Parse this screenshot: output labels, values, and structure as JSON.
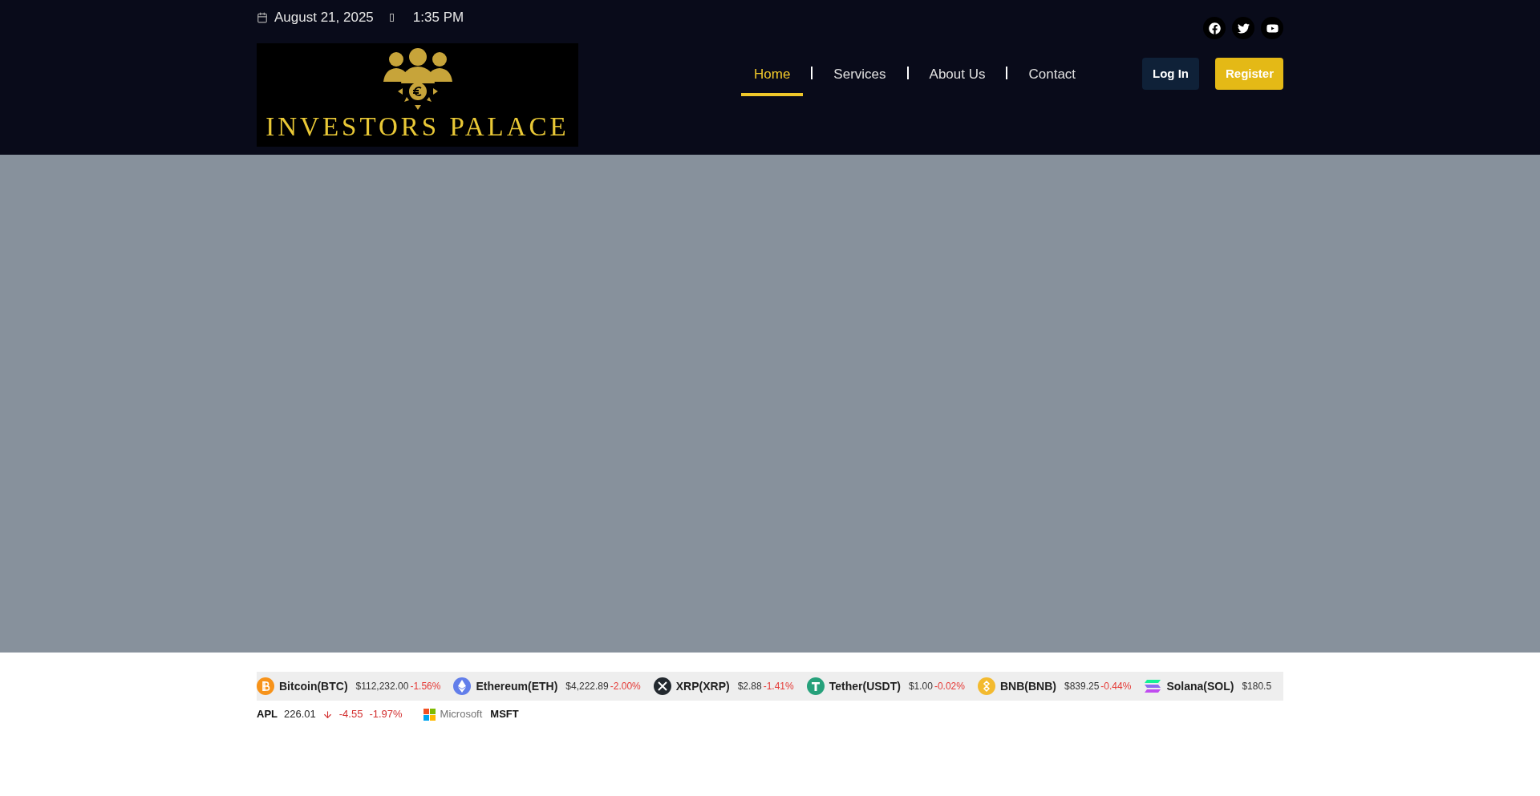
{
  "topbar": {
    "date": "August 21, 2025",
    "time": "1:35 PM"
  },
  "logo": {
    "text": "INVESTORS PALACE"
  },
  "nav": [
    {
      "label": "Home",
      "selected": true
    },
    {
      "label": "Services",
      "selected": false
    },
    {
      "label": "About Us",
      "selected": false
    },
    {
      "label": "Contact",
      "selected": false
    }
  ],
  "buttons": [
    {
      "label": "Log In",
      "kind": "secondary"
    },
    {
      "label": "Register",
      "kind": "primary"
    }
  ],
  "social": [
    {
      "kind": "facebook"
    },
    {
      "kind": "twitter"
    },
    {
      "kind": "youtube"
    }
  ],
  "crypto_ticker": [
    {
      "kind": "btc",
      "name": "Bitcoin(BTC)",
      "price": "$112,232.00",
      "change": "-1.56%"
    },
    {
      "kind": "eth",
      "name": "Ethereum(ETH)",
      "price": "$4,222.89",
      "change": "-2.00%"
    },
    {
      "kind": "xrp",
      "name": "XRP(XRP)",
      "price": "$2.88",
      "change": "-1.41%"
    },
    {
      "kind": "usdt",
      "name": "Tether(USDT)",
      "price": "$1.00",
      "change": "-0.02%"
    },
    {
      "kind": "bnb",
      "name": "BNB(BNB)",
      "price": "$839.25",
      "change": "-0.44%"
    },
    {
      "kind": "sol",
      "name": "Solana(SOL)",
      "price": "$180.5"
    }
  ],
  "stock_ticker": [
    {
      "kind": "quote",
      "symbol": "APL",
      "price": "226.01",
      "change": "-4.55",
      "percent": "-1.97%"
    },
    {
      "kind": "brand",
      "brand": "Microsoft",
      "symbol": "MSFT"
    }
  ]
}
